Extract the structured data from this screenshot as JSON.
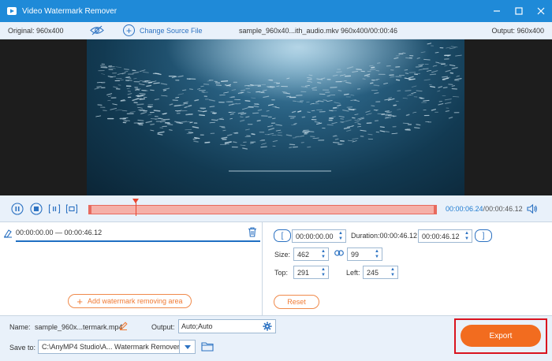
{
  "window": {
    "title": "Video Watermark Remover"
  },
  "infobar": {
    "original": "Original: 960x400",
    "change_source": "Change Source File",
    "filename": "sample_960x40...ith_audio.mkv",
    "fileinfo": "960x400/00:00:46",
    "output": "Output: 960x400"
  },
  "timeline": {
    "current_time": "00:00:06.24",
    "separator": "/",
    "total_time": "00:00:46.12",
    "playhead_fraction": 0.135
  },
  "segment": {
    "range": "00:00:00.00 — 00:00:46.12"
  },
  "add_area_label": "Add watermark removing area",
  "trim": {
    "open_bracket": "[",
    "start": "00:00:00.00",
    "duration": "Duration:00:00:46.12",
    "end": "00:00:46.12",
    "close_bracket": "]"
  },
  "region": {
    "size_label": "Size:",
    "width": "462",
    "height": "99",
    "top_label": "Top:",
    "top": "291",
    "left_label": "Left:",
    "left": "245"
  },
  "reset_label": "Reset",
  "bottom": {
    "name_label": "Name:",
    "name_value": "sample_960x...termark.mp4",
    "output_label": "Output:",
    "output_value": "Auto;Auto",
    "save_label": "Save to:",
    "save_value": "C:\\AnyMP4 Studio\\A... Watermark Remover",
    "export_label": "Export"
  },
  "colors": {
    "titlebar": "#1f8ad8",
    "accent_orange": "#f26c1f",
    "highlight_red": "#d9141f",
    "link_blue": "#2c72c2"
  }
}
